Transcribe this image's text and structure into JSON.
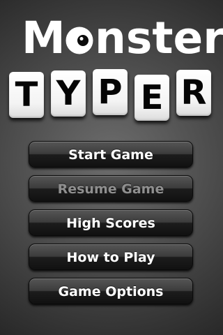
{
  "logo": {
    "word_before": "M",
    "word_after": "nster",
    "eye_icon": "monster-eye-icon",
    "tiles": [
      "T",
      "Y",
      "P",
      "E",
      "R"
    ]
  },
  "menu": {
    "items": [
      {
        "label": "Start Game",
        "enabled": true
      },
      {
        "label": "Resume Game",
        "enabled": false
      },
      {
        "label": "High Scores",
        "enabled": true
      },
      {
        "label": "How to Play",
        "enabled": true
      },
      {
        "label": "Game Options",
        "enabled": true
      }
    ]
  },
  "colors": {
    "background": "#3a3a3a",
    "button": "#2a2a2a",
    "button_text": "#ffffff",
    "button_text_disabled": "#8f8f8f",
    "tile": "#ffffff",
    "tile_text": "#050505"
  }
}
